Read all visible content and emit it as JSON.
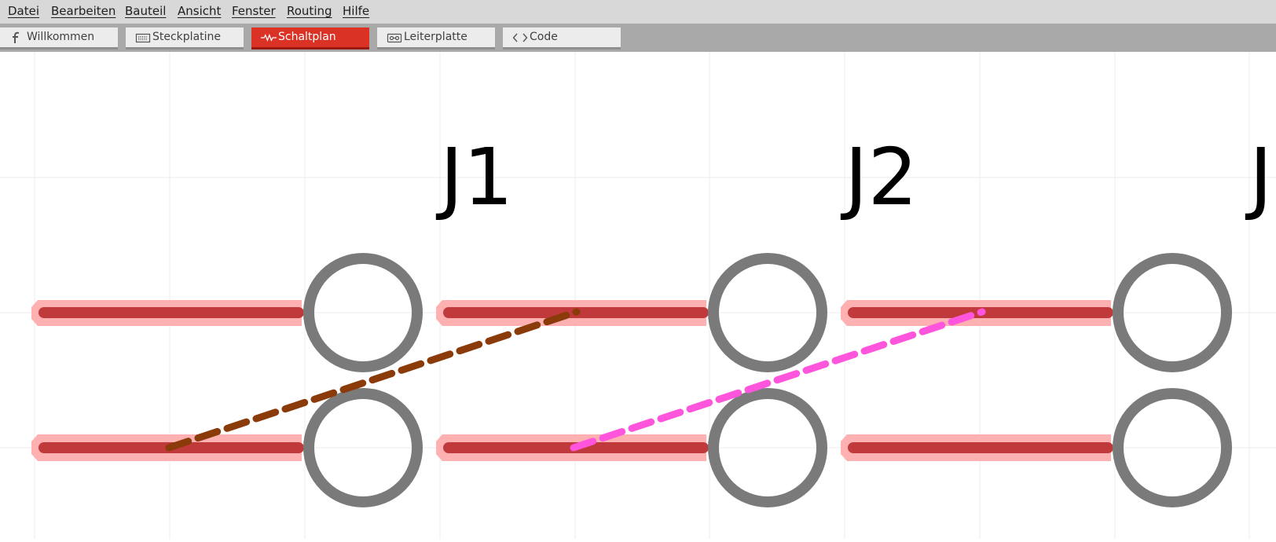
{
  "menu": [
    {
      "label": "Datei"
    },
    {
      "label": "Bearbeiten"
    },
    {
      "label": "Bauteil"
    },
    {
      "label": "Ansicht"
    },
    {
      "label": "Fenster"
    },
    {
      "label": "Routing"
    },
    {
      "label": "Hilfe"
    }
  ],
  "tabs": [
    {
      "label": "Willkommen",
      "icon": "fritzing-logo-icon",
      "active": false
    },
    {
      "label": "Steckplatine",
      "icon": "breadboard-icon",
      "active": false
    },
    {
      "label": "Schaltplan",
      "icon": "schematic-icon",
      "active": true
    },
    {
      "label": "Leiterplatte",
      "icon": "pcb-icon",
      "active": false
    },
    {
      "label": "Code",
      "icon": "code-icon",
      "active": false
    }
  ],
  "schematic": {
    "parts": [
      {
        "ref": "J1"
      },
      {
        "ref": "J2"
      },
      {
        "ref": "J"
      }
    ],
    "ratsnest": [
      {
        "net": "net-1",
        "color": "#8b3a0a"
      },
      {
        "net": "net-2",
        "color": "#ff55dd"
      }
    ],
    "colors": {
      "pin": "#c0393b",
      "pin_highlight": "#ffb0b0",
      "pin_circle": "#7a7a7a",
      "grid": "#ececec",
      "active_tab": "#db3226"
    }
  }
}
